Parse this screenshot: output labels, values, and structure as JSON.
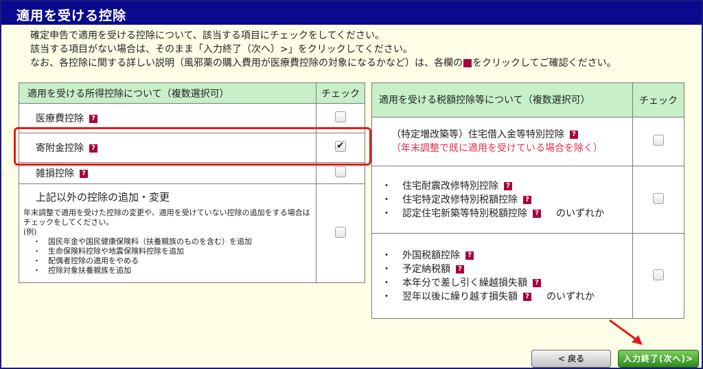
{
  "page": {
    "title": "適用を受ける控除"
  },
  "intro": {
    "line1": "確定申告で適用を受ける控除について、該当する項目にチェックをしてください。",
    "line2": "該当する項目がない場合は、そのまま「入力終了（次へ）>」をクリックしてください。",
    "line3a": "なお、各控除に関する詳しい説明（風邪薬の購入費用が医療費控除の対象になるかなど）は、各欄の",
    "line3b": "をクリックしてご確認ください。"
  },
  "help_icon_text": "?",
  "left_table": {
    "header_label": "適用を受ける所得控除について（複数選択可）",
    "header_check": "チェック",
    "rows": [
      {
        "label": "医療費控除",
        "checked": false
      },
      {
        "label": "寄附金控除",
        "checked": true
      },
      {
        "label": "雑損控除",
        "checked": false
      }
    ],
    "other": {
      "title": "上記以外の控除の追加・変更",
      "desc": "年末調整で適用を受けた控除の変更や、適用を受けていない控除の追加をする場合はチェックをしてください。",
      "example_label": "(例)",
      "items": [
        "国民年金や国民健康保険料（扶養親族のものを含む）を追加",
        "生命保険料控除や地震保険料控除を追加",
        "配偶者控除の適用をやめる",
        "控除対象扶養親族を追加"
      ],
      "checked": false
    }
  },
  "right_table": {
    "header_label": "適用を受ける税額控除等について（複数選択可）",
    "header_check": "チェック",
    "row1": {
      "label": "（特定増改築等）住宅借入金等特別控除",
      "note": "（年末調整で既に適用を受けている場合を除く）",
      "checked": false
    },
    "row2": {
      "items": [
        "住宅耐震改修特別控除",
        "住宅特定改修特別税額控除",
        "認定住宅新築等特別税額控除"
      ],
      "suffix": "のいずれか",
      "checked": false
    },
    "row3": {
      "items": [
        "外国税額控除",
        "予定納税額",
        "本年分で差し引く繰越損失額",
        "翌年以後に繰り越す損失額"
      ],
      "suffix": "のいずれか",
      "checked": false
    }
  },
  "bullet": "・",
  "buttons": {
    "back": "< 戻る",
    "next": "入力終了(次へ)>"
  }
}
